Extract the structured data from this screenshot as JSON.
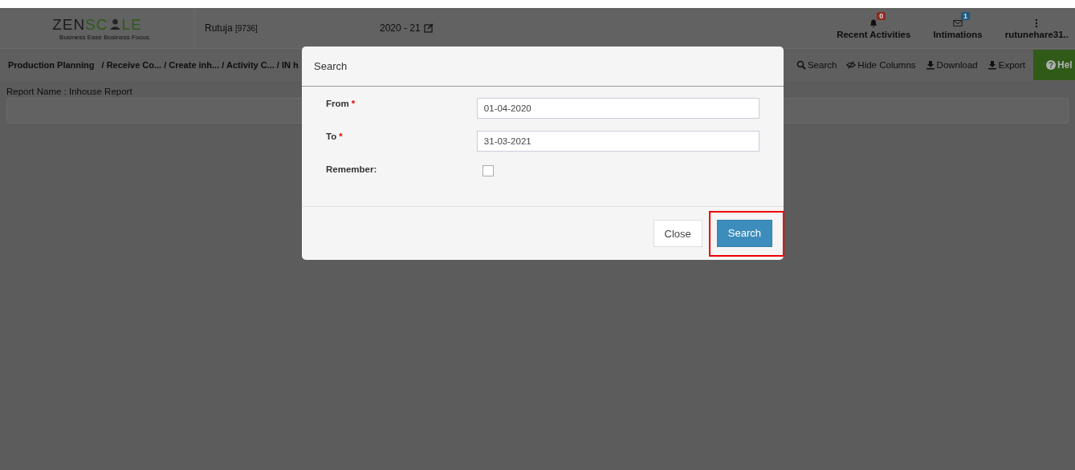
{
  "header": {
    "logo": {
      "part_1": "ZEN",
      "part_2": "SC",
      "part_3": "LE",
      "tagline": "Business Ease Business Focus."
    },
    "user": {
      "name": "Rutuja",
      "code": "[9736]"
    },
    "year": "2020 - 21",
    "notifications": [
      {
        "kind": "bell",
        "label": "Recent Activities",
        "count": "0",
        "color": "#8e2a1e"
      },
      {
        "kind": "envelope",
        "label": "Intimations",
        "count": "1",
        "color": "#1d5a80"
      },
      {
        "kind": "dots",
        "label": "rutunehare31.."
      }
    ]
  },
  "breadcrumb": [
    "Production Planning",
    "/ Receive Co...",
    "/ Create inh...",
    "/ Activity C...",
    "/ IN h"
  ],
  "toolbar": [
    {
      "kind": "search",
      "label": "Search"
    },
    {
      "kind": "eye",
      "label": "Hide Columns"
    },
    {
      "kind": "download",
      "label": "Download"
    },
    {
      "kind": "download",
      "label": "Export"
    },
    {
      "kind": "help",
      "icon": "?",
      "label": "Hel"
    }
  ],
  "report_name": "Report Name : Inhouse Report",
  "modal": {
    "title": "Search",
    "fields": [
      {
        "kind": "text",
        "label": "From",
        "required_mark": "*",
        "value": "01-04-2020"
      },
      {
        "kind": "text",
        "label": "To",
        "required_mark": "*",
        "value": "31-03-2021"
      },
      {
        "kind": "checkbox",
        "label": "Remember:",
        "checked": false
      }
    ],
    "buttons": [
      {
        "kind": "secondary",
        "label": "Close",
        "highlighted": false
      },
      {
        "kind": "primary",
        "label": "Search",
        "highlighted": true
      }
    ]
  }
}
